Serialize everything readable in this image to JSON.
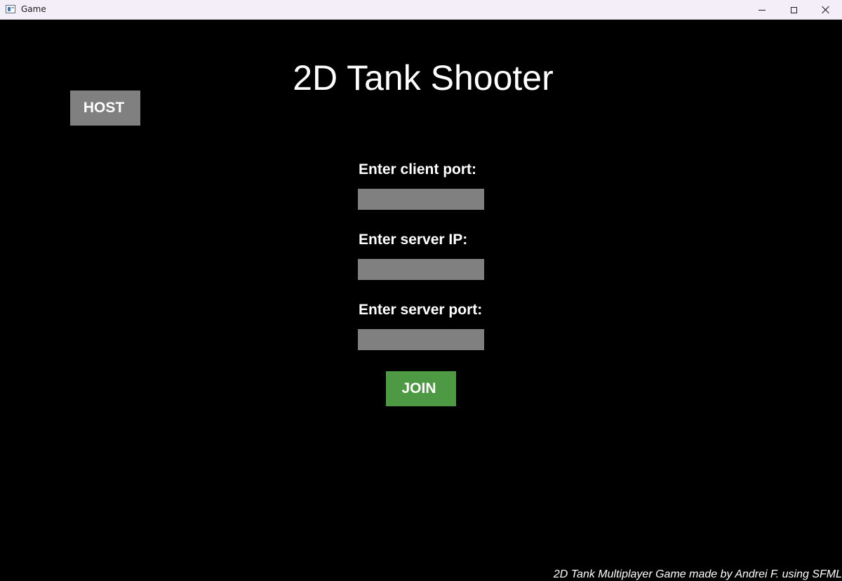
{
  "window": {
    "title": "Game",
    "controls": {
      "minimize": "minimize",
      "maximize": "maximize",
      "close": "close"
    }
  },
  "game": {
    "title": "2D Tank Shooter",
    "host_label": "HOST",
    "join_label": "JOIN",
    "fields": [
      {
        "label": "Enter client port:",
        "value": ""
      },
      {
        "label": "Enter server IP:",
        "value": ""
      },
      {
        "label": "Enter server port:",
        "value": ""
      }
    ],
    "credits": "2D Tank Multiplayer Game made by Andrei F. using SFML"
  },
  "colors": {
    "background": "#000000",
    "button_gray": "#808080",
    "join_green": "#4e9a44",
    "text": "#ffffff",
    "titlebar": "#f3eef8"
  }
}
